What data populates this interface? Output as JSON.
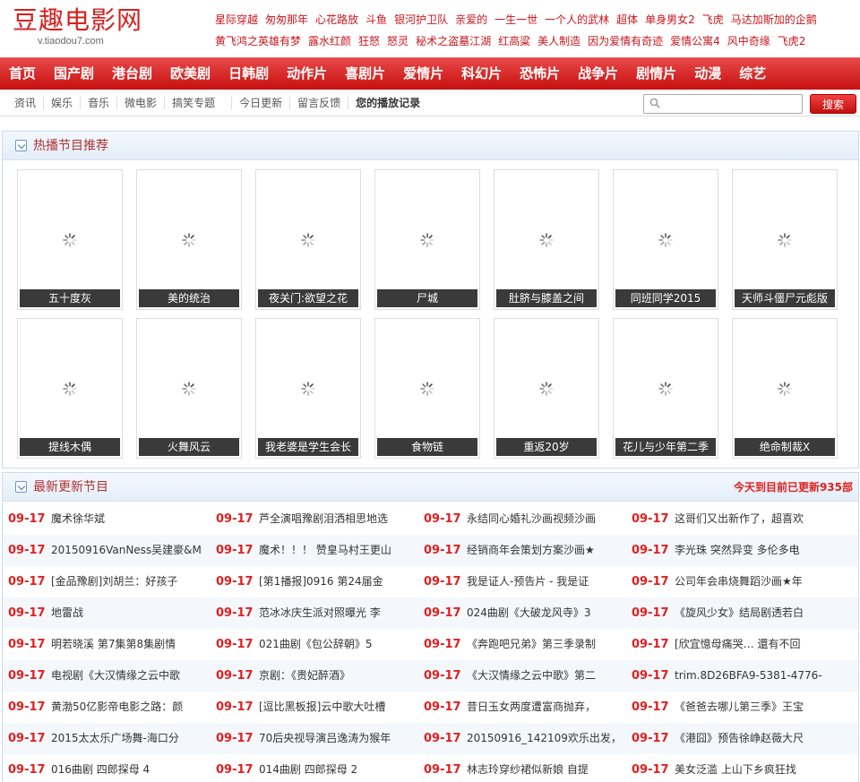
{
  "logo": {
    "main": "豆趣电影网",
    "sub": "v.tiaodou7.com"
  },
  "hot_links": [
    [
      "星际穿越",
      "匆匆那年",
      "心花路放",
      "斗鱼",
      "银河护卫队",
      "亲爱的",
      "一生一世",
      "一个人的武林",
      "超体",
      "单身男女2",
      "飞虎",
      "马达加斯加的企鹅"
    ],
    [
      "黄飞鸿之英雄有梦",
      "露水红颜",
      "狂怒",
      "怒灵",
      "秘术之盗墓江湖",
      "红高粱",
      "美人制造",
      "因为爱情有奇迹",
      "爱情公寓4",
      "风中奇缘",
      "飞虎2"
    ]
  ],
  "nav": [
    "首页",
    "国产剧",
    "港台剧",
    "欧美剧",
    "日韩剧",
    "动作片",
    "喜剧片",
    "爱情片",
    "科幻片",
    "恐怖片",
    "战争片",
    "剧情片",
    "动漫",
    "综艺"
  ],
  "subnav": {
    "group1": [
      "资讯",
      "娱乐",
      "音乐",
      "微电影",
      "搞笑专题"
    ],
    "group2": [
      "今日更新",
      "留言反馈",
      "您的播放记录"
    ]
  },
  "search": {
    "placeholder": "",
    "button": "搜索"
  },
  "hot": {
    "title": "热播节目推荐",
    "items": [
      "五十度灰",
      "美的统治",
      "夜关门:欲望之花",
      "尸城",
      "肚脐与膝盖之间",
      "同班同学2015",
      "天师斗僵尸元彪版",
      "提线木偶",
      "火舞风云",
      "我老婆是学生会长",
      "食物链",
      "重返20岁",
      "花儿与少年第二季",
      "绝命制裁X"
    ]
  },
  "latest": {
    "title": "最新更新节目",
    "summary": "今天到目前已更新935部",
    "rows": [
      [
        [
          "09-17",
          "魔术徐华斌"
        ],
        [
          "09-17",
          "芦全演唱豫剧泪洒相思地选"
        ],
        [
          "09-17",
          "永结同心婚礼沙画视频沙画"
        ],
        [
          "09-17",
          "这哥们又出新作了，超喜欢"
        ]
      ],
      [
        [
          "09-17",
          "20150916VanNess吴建豪&M"
        ],
        [
          "09-17",
          "魔术！！！ 赞皇马村王更山"
        ],
        [
          "09-17",
          "经销商年会策划方案沙画★"
        ],
        [
          "09-17",
          "李光珠 突然异变 多伦多电"
        ]
      ],
      [
        [
          "09-17",
          "[金品豫剧]刘胡兰：好孩子"
        ],
        [
          "09-17",
          "[第1播报]0916 第24届金"
        ],
        [
          "09-17",
          "我是证人-预告片 - 我是证"
        ],
        [
          "09-17",
          "公司年会串烧舞蹈沙画★年"
        ]
      ],
      [
        [
          "09-17",
          "地雷战"
        ],
        [
          "09-17",
          "范冰冰庆生派对照曝光 李"
        ],
        [
          "09-17",
          "024曲剧《大破龙风寺》3"
        ],
        [
          "09-17",
          "《旋风少女》结局剧透若白"
        ]
      ],
      [
        [
          "09-17",
          "明若晓溪 第7集第8集剧情"
        ],
        [
          "09-17",
          "021曲剧《包公辞朝》5"
        ],
        [
          "09-17",
          "《奔跑吧兄弟》第三季录制"
        ],
        [
          "09-17",
          "[欣宜憶母痛哭… 還有不回"
        ]
      ],
      [
        [
          "09-17",
          "电视剧《大汉情缘之云中歌"
        ],
        [
          "09-17",
          "京剧：《贵妃醉酒》"
        ],
        [
          "09-17",
          "《大汉情缘之云中歌》第二"
        ],
        [
          "09-17",
          "trim.8D26BFA9-5381-4776-"
        ]
      ],
      [
        [
          "09-17",
          "黄渤50亿影帝电影之路：颜"
        ],
        [
          "09-17",
          "[逗比黑板报]云中歌大吐槽"
        ],
        [
          "09-17",
          "昔日玉女两度遭富商抛弃，"
        ],
        [
          "09-17",
          "《爸爸去哪儿第三季》王宝"
        ]
      ],
      [
        [
          "09-17",
          "2015太太乐广场舞-海口分"
        ],
        [
          "09-17",
          "70后央视导演吕逸涛为猴年"
        ],
        [
          "09-17",
          "20150916_142109欢乐出发，"
        ],
        [
          "09-17",
          "《港囧》预告徐峥赵薇大尺"
        ]
      ],
      [
        [
          "09-17",
          "016曲剧 四郎探母 4"
        ],
        [
          "09-17",
          "014曲剧 四郎探母 2"
        ],
        [
          "09-17",
          "林志玲穿纱裙似新娘 自提"
        ],
        [
          "09-17",
          "美女泛滥 上山下乡疯狂找"
        ]
      ]
    ]
  }
}
